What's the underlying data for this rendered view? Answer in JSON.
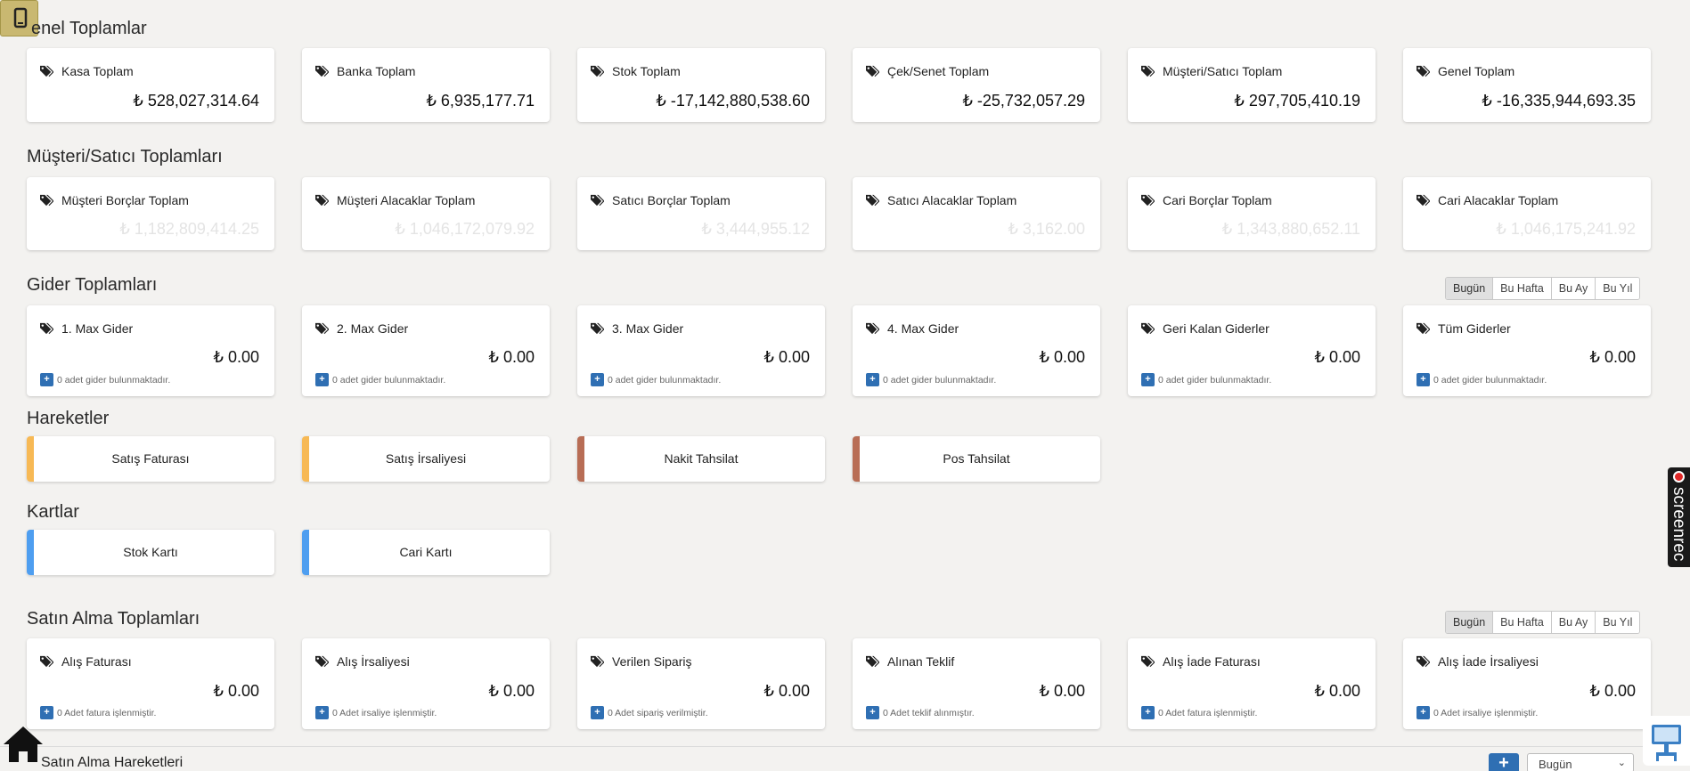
{
  "currency": "₺",
  "genel": {
    "title": "enel Toplamlar",
    "cards": [
      {
        "label": "Kasa Toplam",
        "value": "₺ 528,027,314.64"
      },
      {
        "label": "Banka Toplam",
        "value": "₺ 6,935,177.71"
      },
      {
        "label": "Stok Toplam",
        "value": "₺ -17,142,880,538.60"
      },
      {
        "label": "Çek/Senet Toplam",
        "value": "₺ -25,732,057.29"
      },
      {
        "label": "Müşteri/Satıcı Toplam",
        "value": "₺ 297,705,410.19"
      },
      {
        "label": "Genel Toplam",
        "value": "₺ -16,335,944,693.35"
      }
    ]
  },
  "musteri": {
    "title": "Müşteri/Satıcı Toplamları",
    "cards": [
      {
        "label": "Müşteri Borçlar Toplam",
        "value": "₺ 1,182,809,414.25"
      },
      {
        "label": "Müşteri Alacaklar Toplam",
        "value": "₺ 1,046,172,079.92"
      },
      {
        "label": "Satıcı Borçlar Toplam",
        "value": "₺ 3,444,955.12"
      },
      {
        "label": "Satıcı Alacaklar Toplam",
        "value": "₺ 3,162.00"
      },
      {
        "label": "Cari Borçlar Toplam",
        "value": "₺ 1,343,880,652.11"
      },
      {
        "label": "Cari Alacaklar Toplam",
        "value": "₺ 1,046,175,241.92"
      }
    ]
  },
  "gider": {
    "title": "Gider Toplamları",
    "periods": [
      "Bugün",
      "Bu Hafta",
      "Bu Ay",
      "Bu Yıl"
    ],
    "active_period": "Bugün",
    "cards": [
      {
        "label": "1. Max Gider",
        "value": "₺ 0.00",
        "note": "0 adet gider bulunmaktadır."
      },
      {
        "label": "2. Max Gider",
        "value": "₺ 0.00",
        "note": "0 adet gider bulunmaktadır."
      },
      {
        "label": "3. Max Gider",
        "value": "₺ 0.00",
        "note": "0 adet gider bulunmaktadır."
      },
      {
        "label": "4. Max Gider",
        "value": "₺ 0.00",
        "note": "0 adet gider bulunmaktadır."
      },
      {
        "label": "Geri Kalan Giderler",
        "value": "₺ 0.00",
        "note": "0 adet gider bulunmaktadır."
      },
      {
        "label": "Tüm Giderler",
        "value": "₺ 0.00",
        "note": "0 adet gider bulunmaktadır."
      }
    ]
  },
  "hareketler": {
    "title": "Hareketler",
    "items": [
      {
        "label": "Satış Faturası",
        "color": "#f7b955"
      },
      {
        "label": "Satış İrsaliyesi",
        "color": "#f7b955"
      },
      {
        "label": "Nakit Tahsilat",
        "color": "#b86d55"
      },
      {
        "label": "Pos Tahsilat",
        "color": "#b86d55"
      }
    ]
  },
  "kartlar": {
    "title": "Kartlar",
    "items": [
      {
        "label": "Stok Kartı",
        "color": "#4e9ef0"
      },
      {
        "label": "Cari Kartı",
        "color": "#4e9ef0"
      }
    ]
  },
  "satin_alma": {
    "title": "Satın Alma Toplamları",
    "periods": [
      "Bugün",
      "Bu Hafta",
      "Bu Ay",
      "Bu Yıl"
    ],
    "active_period": "Bugün",
    "cards": [
      {
        "label": "Alış Faturası",
        "value": "₺ 0.00",
        "note": "0 Adet fatura işlenmiştir."
      },
      {
        "label": "Alış İrsaliyesi",
        "value": "₺ 0.00",
        "note": "0 Adet irsaliye işlenmiştir."
      },
      {
        "label": "Verilen Sipariş",
        "value": "₺ 0.00",
        "note": "0 Adet sipariş verilmiştir."
      },
      {
        "label": "Alınan Teklif",
        "value": "₺ 0.00",
        "note": "0 Adet teklif alınmıştır."
      },
      {
        "label": "Alış İade Faturası",
        "value": "₺ 0.00",
        "note": "0 Adet fatura işlenmiştir."
      },
      {
        "label": "Alış İade İrsaliyesi",
        "value": "₺ 0.00",
        "note": "0 Adet irsaliye işlenmiştir."
      }
    ]
  },
  "bottom": {
    "title": "Satın Alma Hareketleri",
    "add_label": "+",
    "select_value": "Bugün"
  },
  "screenrec": {
    "label": "screenrec"
  },
  "colors": {
    "accent_blue": "#2f6fb3",
    "phone_button": "#c9b871"
  }
}
